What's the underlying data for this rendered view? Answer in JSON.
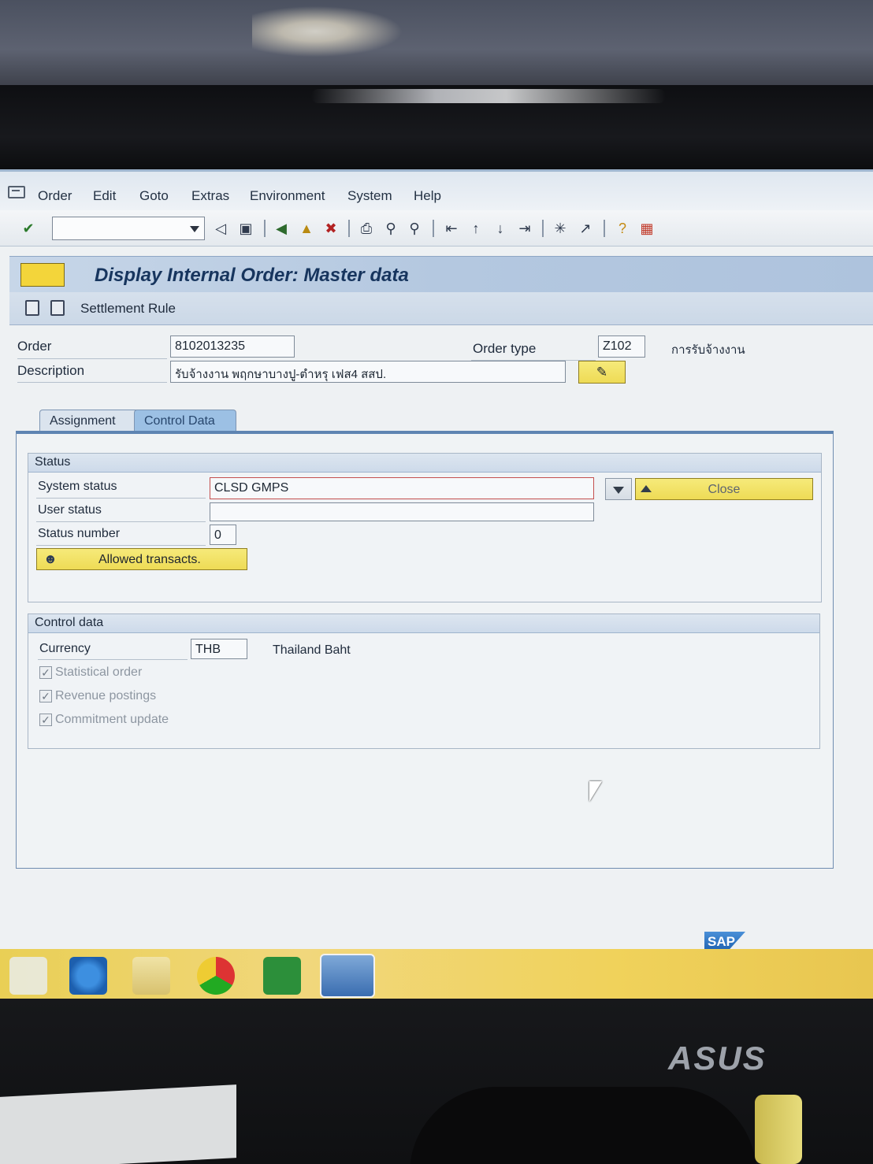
{
  "menu": {
    "items": [
      "Order",
      "Edit",
      "Goto",
      "Extras",
      "Environment",
      "System",
      "Help"
    ]
  },
  "toolbar": {
    "command_field_value": ""
  },
  "header": {
    "title": "Display Internal Order: Master data",
    "app_toolbar_label": "Settlement Rule"
  },
  "form": {
    "order_label": "Order",
    "order_value": "8102013235",
    "order_type_label": "Order type",
    "order_type_value": "Z102",
    "order_type_text": "การรับจ้างงาน",
    "description_label": "Description",
    "description_value": "รับจ้างงาน พฤกษาบางปู-ตำหรุ เฟส4 สสป."
  },
  "tabs": [
    {
      "label": "Assignment",
      "active": false
    },
    {
      "label": "Control Data",
      "active": true
    }
  ],
  "status_group": {
    "title": "Status",
    "system_status_label": "System status",
    "system_status_value": "CLSD GMPS",
    "user_status_label": "User status",
    "user_status_value": "",
    "status_number_label": "Status number",
    "status_number_value": "0",
    "allowed_button": "Allowed transacts.",
    "close_button": "Close"
  },
  "control_group": {
    "title": "Control data",
    "currency_label": "Currency",
    "currency_value": "THB",
    "currency_text": "Thailand Baht",
    "checkboxes": [
      {
        "label": "Statistical order",
        "checked": true,
        "enabled": false
      },
      {
        "label": "Revenue postings",
        "checked": true,
        "enabled": false
      },
      {
        "label": "Commitment update",
        "checked": true,
        "enabled": false
      }
    ]
  },
  "branding": {
    "sap": "SAP",
    "monitor": "ASUS"
  },
  "icons": {
    "toolbar": [
      "enter-icon",
      "back-icon",
      "save-icon",
      "green-back-icon",
      "exit-icon",
      "cancel-icon",
      "print-icon",
      "find-icon",
      "find-next-icon",
      "first-page-icon",
      "prev-page-icon",
      "next-page-icon",
      "last-page-icon",
      "new-session-icon",
      "shortcut-icon",
      "help-icon",
      "layout-menu-icon"
    ]
  },
  "colors": {
    "title_bar": "#b4c8e0",
    "accent_yellow": "#eedb55",
    "tab_active": "#9cc0e4"
  }
}
